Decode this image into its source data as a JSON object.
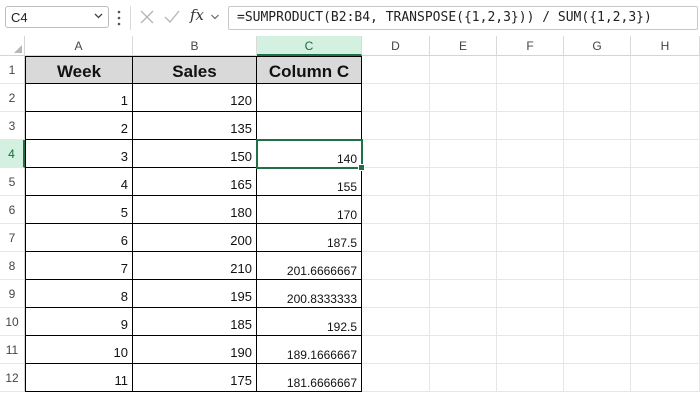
{
  "formula_bar": {
    "name_box": "C4",
    "fx_label": "fx",
    "formula": "=SUMPRODUCT(B2:B4, TRANSPOSE({1,2,3})) / SUM({1,2,3})"
  },
  "columns": [
    "A",
    "B",
    "C",
    "D",
    "E",
    "F",
    "G",
    "H"
  ],
  "rows": [
    "1",
    "2",
    "3",
    "4",
    "5",
    "6",
    "7",
    "8",
    "9",
    "10",
    "11",
    "12"
  ],
  "table": {
    "headers": [
      "Week",
      "Sales",
      "Column C"
    ],
    "week": [
      "1",
      "2",
      "3",
      "4",
      "5",
      "6",
      "7",
      "8",
      "9",
      "10",
      "11"
    ],
    "sales": [
      "120",
      "135",
      "150",
      "165",
      "180",
      "200",
      "210",
      "195",
      "185",
      "190",
      "175"
    ],
    "column_c": [
      "",
      "",
      "140",
      "155",
      "170",
      "187.5",
      "201.6666667",
      "200.8333333",
      "192.5",
      "189.1666667",
      "181.6666667"
    ]
  },
  "active_cell": "C4",
  "colors": {
    "accent": "#1e7145",
    "header_fill": "#d9d9d9"
  }
}
